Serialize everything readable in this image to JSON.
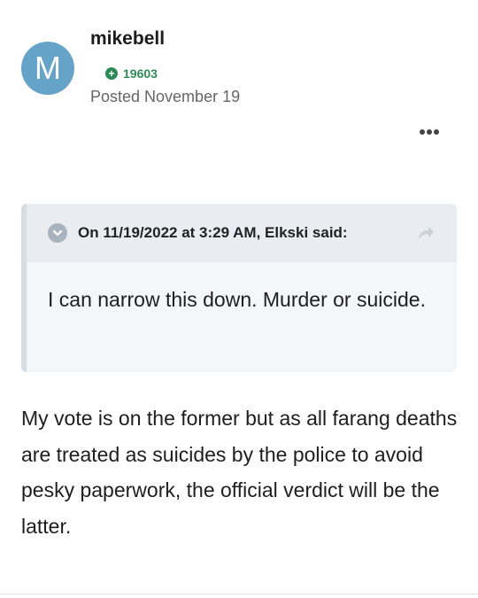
{
  "post": {
    "author": "mikebell",
    "avatar_letter": "M",
    "reputation": "19603",
    "posted": "Posted November 19",
    "body": "My vote is on the former but as all farang deaths are treated as suicides by the police to avoid pesky paperwork, the official verdict will be the latter."
  },
  "quote": {
    "citation": "On 11/19/2022 at 3:29 AM, Elkski said:",
    "text": "I can narrow this down. Murder or suicide."
  },
  "icons": {
    "reputation": "plus-circle-icon",
    "menu": "more-horizontal-icon",
    "collapse": "chevron-down-icon",
    "share": "share-arrow-icon"
  },
  "colors": {
    "avatar_bg": "#66a3c9",
    "reputation": "#2e8b57",
    "quote_bg": "#f4f7fa",
    "quote_header_bg": "#e9edf1"
  }
}
